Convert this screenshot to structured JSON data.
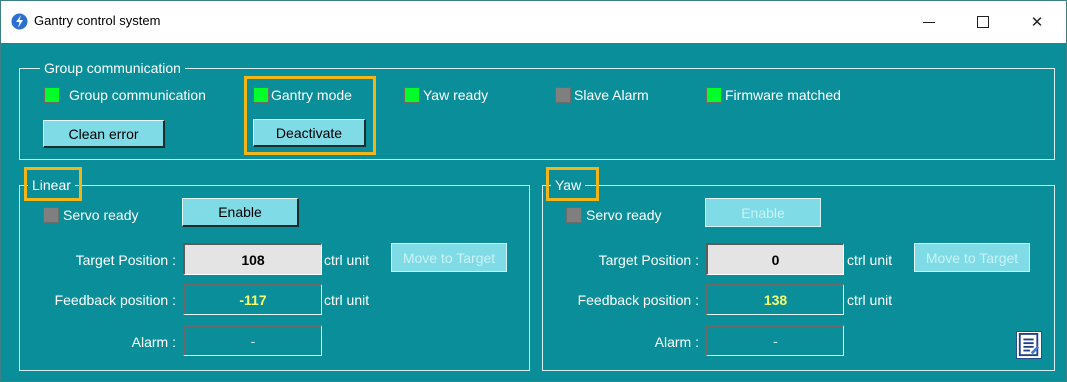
{
  "window": {
    "title": "Gantry control system",
    "minimize_icon": "minimize-icon",
    "maximize_icon": "maximize-icon",
    "close_icon": "close-icon",
    "close_glyph": "✕"
  },
  "group_comm": {
    "legend": "Group communication",
    "indicators": [
      {
        "label": "Group communication",
        "state": "green"
      },
      {
        "label": "Gantry mode",
        "state": "green"
      },
      {
        "label": "Yaw ready",
        "state": "green"
      },
      {
        "label": "Slave Alarm",
        "state": "gray"
      },
      {
        "label": "Firmware matched",
        "state": "green"
      }
    ],
    "clean_error_label": "Clean error",
    "deactivate_label": "Deactivate"
  },
  "linear": {
    "legend": "Linear",
    "servo_ready_label": "Servo ready",
    "enable_label": "Enable",
    "target_position_label": "Target Position :",
    "target_position_value": "108",
    "target_unit": "ctrl unit",
    "move_to_target_label": "Move to Target",
    "feedback_label": "Feedback position :",
    "feedback_value": "-117",
    "feedback_unit": "ctrl unit",
    "alarm_label": "Alarm :",
    "alarm_value": "-"
  },
  "yaw": {
    "legend": "Yaw",
    "servo_ready_label": "Servo ready",
    "enable_label": "Enable",
    "target_position_label": "Target Position :",
    "target_position_value": "0",
    "target_unit": "ctrl unit",
    "move_to_target_label": "Move to Target",
    "feedback_label": "Feedback position :",
    "feedback_value": "138",
    "feedback_unit": "ctrl unit",
    "alarm_label": "Alarm :",
    "alarm_value": "-"
  },
  "colors": {
    "background": "#0a8f9a",
    "led_on": "#00ff2a",
    "led_off": "#7f7f7f",
    "highlight": "#f2b51a",
    "readout_text": "#f5ff6e"
  }
}
